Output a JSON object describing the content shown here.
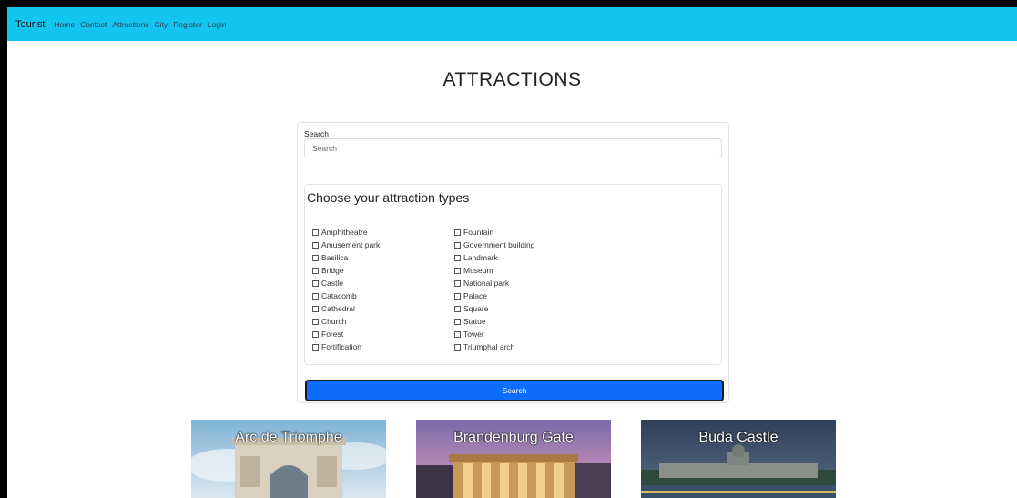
{
  "navbar": {
    "brand": "Tourist",
    "links": [
      "Home",
      "Contact",
      "Attractions",
      "City",
      "Register",
      "Login"
    ],
    "color": "#12c5ee"
  },
  "page": {
    "title": "ATTRACTIONS"
  },
  "search": {
    "label": "Search",
    "placeholder": "Search",
    "value": ""
  },
  "types": {
    "title": "Choose your attraction types",
    "column1": [
      "Amphitheatre",
      "Amusement park",
      "Basilica",
      "Bridge",
      "Castle",
      "Catacomb",
      "Cathedral",
      "Church",
      "Forest",
      "Fortification"
    ],
    "column2": [
      "Fountain",
      "Government building",
      "Landmark",
      "Museum",
      "National park",
      "Palace",
      "Square",
      "Statue",
      "Tower",
      "Triumphal arch"
    ]
  },
  "search_button": {
    "label": "Search",
    "color": "#0d6efd"
  },
  "cards": [
    {
      "title": "Arc de Triomphe"
    },
    {
      "title": "Brandenburg Gate"
    },
    {
      "title": "Buda Castle"
    }
  ]
}
